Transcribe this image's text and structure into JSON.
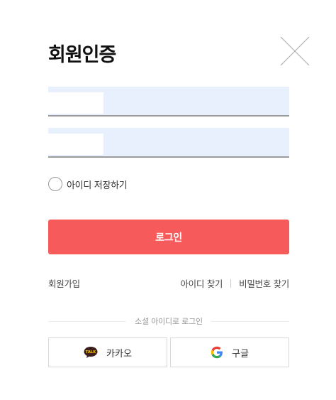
{
  "header": {
    "title": "회원인증"
  },
  "form": {
    "id_value": "",
    "password_value": "",
    "remember_label": "아이디 저장하기",
    "remember_checked": false,
    "login_label": "로그인"
  },
  "links": {
    "join": "회원가입",
    "find_id": "아이디 찾기",
    "find_password": "비밀번호 찾기"
  },
  "social": {
    "separator": "소셜 아이디로 로그인",
    "kakao_label": "카카오",
    "google_label": "구글",
    "kakao_badge": "TALK"
  },
  "colors": {
    "primary": "#f75a5a",
    "field_background": "#e8f0fe",
    "kakao_yellow": "#ffcd00"
  },
  "icons": {
    "close": "close-icon",
    "kakao": "kakao-talk-icon",
    "google": "google-g-icon"
  }
}
